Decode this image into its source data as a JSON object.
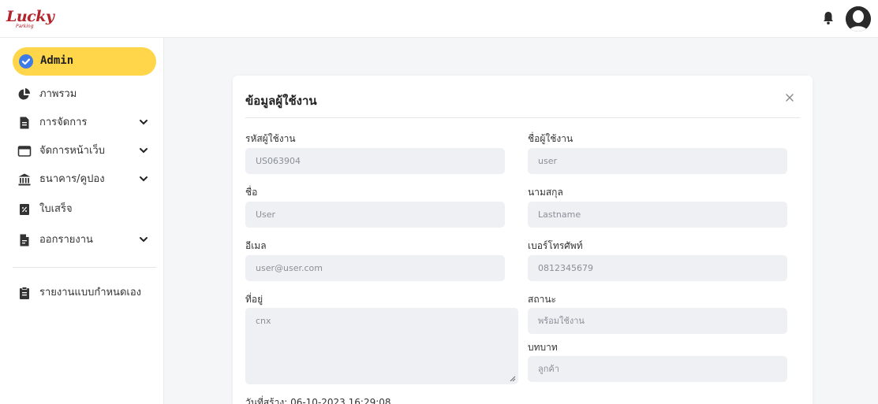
{
  "header": {
    "logo_text": "Lucky",
    "logo_subtext": "Parking"
  },
  "sidebar": {
    "active": {
      "label": "Admin"
    },
    "items": [
      {
        "label": "ภาพรวม",
        "icon": "pie-chart-icon",
        "has_chevron": false
      },
      {
        "label": "การจัดการ",
        "icon": "document-icon",
        "has_chevron": true
      },
      {
        "label": "จัดการหน้าเว็บ",
        "icon": "browser-window-icon",
        "has_chevron": true
      },
      {
        "label": "ธนาคาร/คูปอง",
        "icon": "bank-icon",
        "has_chevron": true
      },
      {
        "label": "ใบเสร็จ",
        "icon": "receipt-icon",
        "has_chevron": false
      },
      {
        "label": "ออกรายงาน",
        "icon": "report-file-icon",
        "has_chevron": true
      },
      {
        "label": "รายงานแบบกำหนดเอง",
        "icon": "clipboard-icon",
        "has_chevron": false
      }
    ]
  },
  "modal": {
    "title": "ข้อมูลผู้ใช้งาน",
    "fields": {
      "user_id": {
        "label": "รหัสผู้ใช้งาน",
        "value": "US063904"
      },
      "username": {
        "label": "ชื่อผู้ใช้งาน",
        "value": "user"
      },
      "first_name": {
        "label": "ชื่อ",
        "value": "User"
      },
      "last_name": {
        "label": "นามสกุล",
        "value": "Lastname"
      },
      "email": {
        "label": "อีเมล",
        "value": "user@user.com"
      },
      "phone": {
        "label": "เบอร์โทรศัพท์",
        "value": "0812345679"
      },
      "address": {
        "label": "ที่อยู่",
        "value": "cnx"
      },
      "status": {
        "label": "สถานะ",
        "value": "พร้อมใช้งาน"
      },
      "role": {
        "label": "บทบาท",
        "value": "ลูกค้า"
      }
    },
    "created_at": "วันที่สร้าง: 06-10-2023 16:29:08"
  },
  "colors": {
    "accent": "#ffd54a",
    "brand": "#b3232b",
    "check": "#3c7be8",
    "input_bg": "#eef0f3"
  }
}
